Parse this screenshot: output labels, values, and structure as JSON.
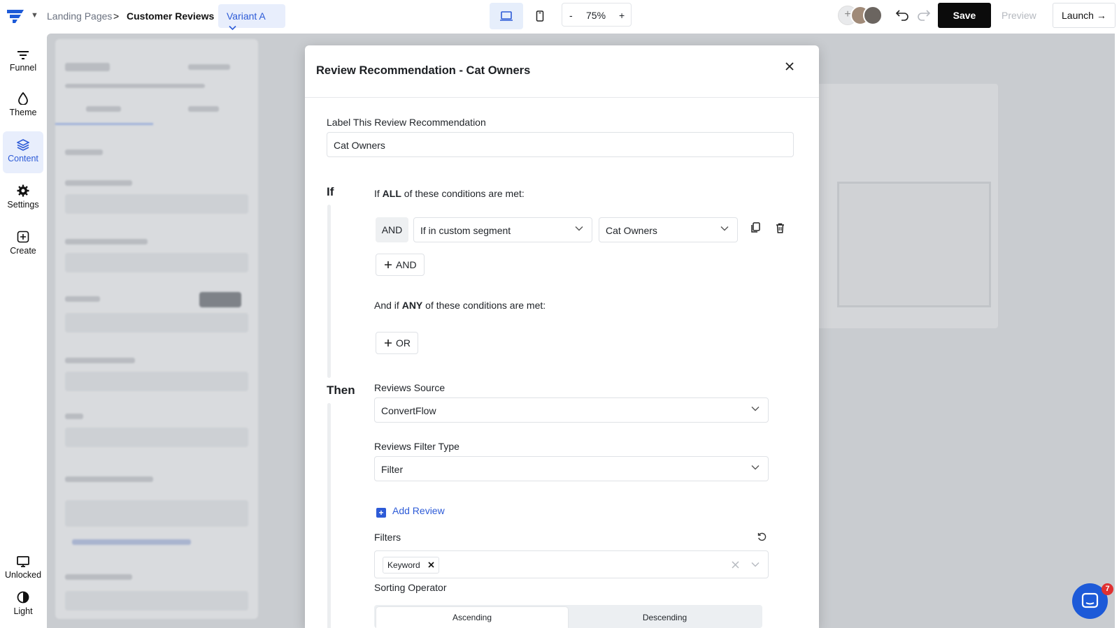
{
  "topbar": {
    "breadcrumb": [
      "Landing Pages",
      ">",
      "Customer Reviews"
    ],
    "variant": "Variant A",
    "zoom": {
      "minus": "-",
      "value": "75%",
      "plus": "+"
    },
    "save": "Save",
    "preview": "Preview",
    "launch": "Launch →"
  },
  "rail": {
    "items": [
      "Funnel",
      "Theme",
      "Content",
      "Settings",
      "Create"
    ],
    "bottom": [
      "Unlocked",
      "Light"
    ],
    "active": "Content"
  },
  "modal": {
    "title": "Review Recommendation - Cat Owners",
    "label_title": "Label This Review Recommendation",
    "label_value": "Cat Owners",
    "if": {
      "heading": "If",
      "all_prefix": "If ",
      "all_bold": "ALL",
      "all_suffix": " of these conditions are met:",
      "and_tag": "AND",
      "condition_type": "If in custom segment",
      "condition_value": "Cat Owners",
      "add_and": "AND",
      "any_prefix": "And if ",
      "any_bold": "ANY",
      "any_suffix": " of these conditions are met:",
      "add_or": "OR"
    },
    "then": {
      "heading": "Then",
      "source_label": "Reviews Source",
      "source_value": "ConvertFlow",
      "filter_type_label": "Reviews Filter Type",
      "filter_type_value": "Filter",
      "add_review": "Add Review",
      "filters_label": "Filters",
      "filter_chip": "Keyword",
      "sorting_label": "Sorting Operator",
      "sort_options": [
        "Ascending",
        "Descending"
      ],
      "sort_selected": "Ascending"
    }
  },
  "chat": {
    "badge": "7"
  },
  "colors": {
    "accent": "#2d5bd7",
    "save_bg": "#0b0b0b",
    "chat": "#1d5ad8",
    "badge": "#e03131"
  }
}
